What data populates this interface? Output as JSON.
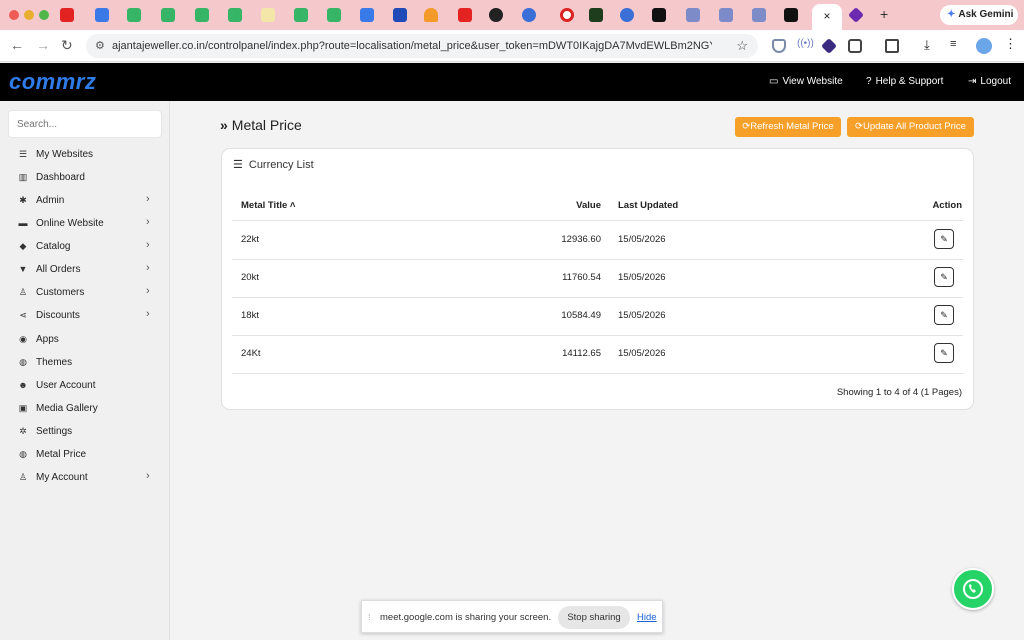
{
  "browser": {
    "url": "ajantajeweller.co.in/controlpanel/index.php?route=localisation/metal_price&user_token=mDWT0IKajgDA7MvdEWLBm2NGYODW...",
    "ask_gemini": "Ask Gemini",
    "active_tab_close": "×",
    "new_tab": "+"
  },
  "header": {
    "logo": "commrz",
    "view_website": "View Website",
    "help_support": "Help & Support",
    "logout": "Logout"
  },
  "sidebar": {
    "search_placeholder": "Search...",
    "items": [
      {
        "label": "My Websites",
        "icon": "list-icon",
        "has_submenu": false
      },
      {
        "label": "Dashboard",
        "icon": "bar-chart-icon",
        "has_submenu": false
      },
      {
        "label": "Admin",
        "icon": "gear-icon",
        "has_submenu": true
      },
      {
        "label": "Online Website",
        "icon": "credit-card-icon",
        "has_submenu": true
      },
      {
        "label": "Catalog",
        "icon": "tags-icon",
        "has_submenu": true
      },
      {
        "label": "All Orders",
        "icon": "cart-icon",
        "has_submenu": true
      },
      {
        "label": "Customers",
        "icon": "user-icon",
        "has_submenu": true
      },
      {
        "label": "Discounts",
        "icon": "share-icon",
        "has_submenu": true
      },
      {
        "label": "Apps",
        "icon": "puzzle-icon",
        "has_submenu": false
      },
      {
        "label": "Themes",
        "icon": "globe-icon",
        "has_submenu": false
      },
      {
        "label": "User Account",
        "icon": "users-icon",
        "has_submenu": false
      },
      {
        "label": "Media Gallery",
        "icon": "image-icon",
        "has_submenu": false
      },
      {
        "label": "Settings",
        "icon": "cog-icon",
        "has_submenu": false
      },
      {
        "label": "Metal Price",
        "icon": "globe-icon",
        "has_submenu": false
      },
      {
        "label": "My Account",
        "icon": "user-icon",
        "has_submenu": true
      }
    ]
  },
  "main": {
    "page_title": "Metal Price",
    "refresh_button": "Refresh Metal Price",
    "update_all_button": "Update All Product Price",
    "card_title": "Currency List",
    "columns": {
      "metal_title": "Metal Title",
      "value": "Value",
      "last_updated": "Last Updated",
      "action": "Action"
    },
    "rows": [
      {
        "title": "22kt",
        "value": "12936.60",
        "updated": "15/05/2026"
      },
      {
        "title": "20kt",
        "value": "11760.54",
        "updated": "15/05/2026"
      },
      {
        "title": "18kt",
        "value": "10584.49",
        "updated": "15/05/2026"
      },
      {
        "title": "24Kt",
        "value": "14112.65",
        "updated": "15/05/2026"
      }
    ],
    "pagination": "Showing 1 to 4 of 4 (1 Pages)"
  },
  "sharing": {
    "message": "meet.google.com is sharing your screen.",
    "stop": "Stop sharing",
    "hide": "Hide"
  },
  "colors": {
    "accent_orange": "#f6a02a",
    "logo_blue": "#2f7be8",
    "header_black": "#000000",
    "whatsapp_green": "#25d366"
  }
}
